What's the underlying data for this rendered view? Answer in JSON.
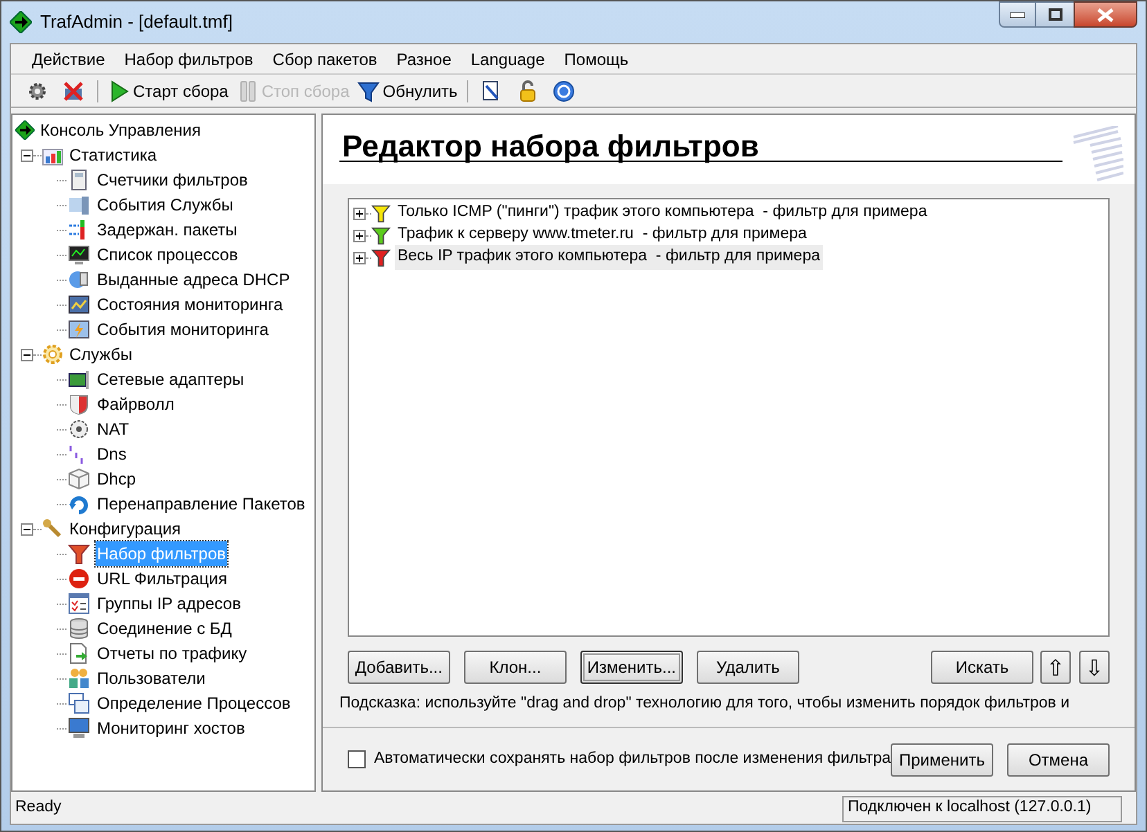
{
  "window": {
    "title": "TrafAdmin - [default.tmf]"
  },
  "menu": [
    "Действие",
    "Набор фильтров",
    "Сбор пакетов",
    "Разное",
    "Language",
    "Помощь"
  ],
  "toolbar": [
    {
      "kind": "icon"
    },
    {
      "kind": "icon"
    },
    {
      "kind": "sep"
    },
    {
      "kind": "play",
      "label": "Старт сбора",
      "disabled": false
    },
    {
      "kind": "pause",
      "label": "Стоп сбора",
      "disabled": true
    },
    {
      "kind": "funnel",
      "label": "Обнулить",
      "disabled": false
    },
    {
      "kind": "sep"
    },
    {
      "kind": "icon"
    },
    {
      "kind": "icon"
    },
    {
      "kind": "help"
    }
  ],
  "tree": {
    "label": "Консоль Управления",
    "children": [
      {
        "label": "Статистика",
        "expanded": true,
        "children": [
          {
            "label": "Счетчики фильтров",
            "selected": false
          },
          {
            "label": "События Службы",
            "selected": false
          },
          {
            "label": "Задержан. пакеты",
            "selected": false
          },
          {
            "label": "Список процессов",
            "selected": false
          },
          {
            "label": "Выданные адреса DHCP",
            "selected": false
          },
          {
            "label": "Состояния мониторинга",
            "selected": false
          },
          {
            "label": "События мониторинга",
            "selected": false
          }
        ]
      },
      {
        "label": "Службы",
        "expanded": true,
        "children": [
          {
            "label": "Сетевые адаптеры",
            "selected": false
          },
          {
            "label": "Файрволл",
            "selected": false
          },
          {
            "label": "NAT",
            "selected": false
          },
          {
            "label": "Dns",
            "selected": false
          },
          {
            "label": "Dhcp",
            "selected": false
          },
          {
            "label": "Перенаправление Пакетов",
            "selected": false
          }
        ]
      },
      {
        "label": "Конфигурация",
        "expanded": true,
        "children": [
          {
            "label": "Набор фильтров",
            "selected": true
          },
          {
            "label": "URL Фильтрация",
            "selected": false
          },
          {
            "label": "Группы IP адресов",
            "selected": false
          },
          {
            "label": "Соединение с БД",
            "selected": false
          },
          {
            "label": "Отчеты по трафику",
            "selected": false
          },
          {
            "label": "Пользователи",
            "selected": false
          },
          {
            "label": "Определение Процессов",
            "selected": false
          },
          {
            "label": "Мониторинг хостов",
            "selected": false
          }
        ]
      }
    ]
  },
  "editor": {
    "title": "Редактор набора фильтров",
    "filters": [
      {
        "label": "Только ICMP (\"пинги\") трафик этого компьютера  - фильтр для примера",
        "color": "#f5e50a",
        "expanded": false,
        "selected": false
      },
      {
        "label": "Трафик к серверу www.tmeter.ru  - фильтр для примера",
        "color": "#5ccc1c",
        "expanded": false,
        "selected": false
      },
      {
        "label": "Весь IP трафик этого компьютера  - фильтр для примера",
        "color": "#e02020",
        "expanded": false,
        "selected": true
      }
    ],
    "buttons": [
      "Добавить...",
      "Клон...",
      "Изменить...",
      "Удалить"
    ],
    "search_button": "Искать",
    "move_up": "⇧",
    "move_down": "⇩",
    "hint": "Подсказка: используйте \"drag and drop\" технологию для того, чтобы изменить порядок фильтров и",
    "autosave": {
      "label": "Автоматически сохранять набор фильтров после изменения фильтра",
      "checked": false
    },
    "apply_button": "Применить",
    "cancel_button": "Отмена"
  },
  "status_bar": {
    "left": "Ready",
    "right": "Подключен к localhost (127.0.0.1)"
  }
}
